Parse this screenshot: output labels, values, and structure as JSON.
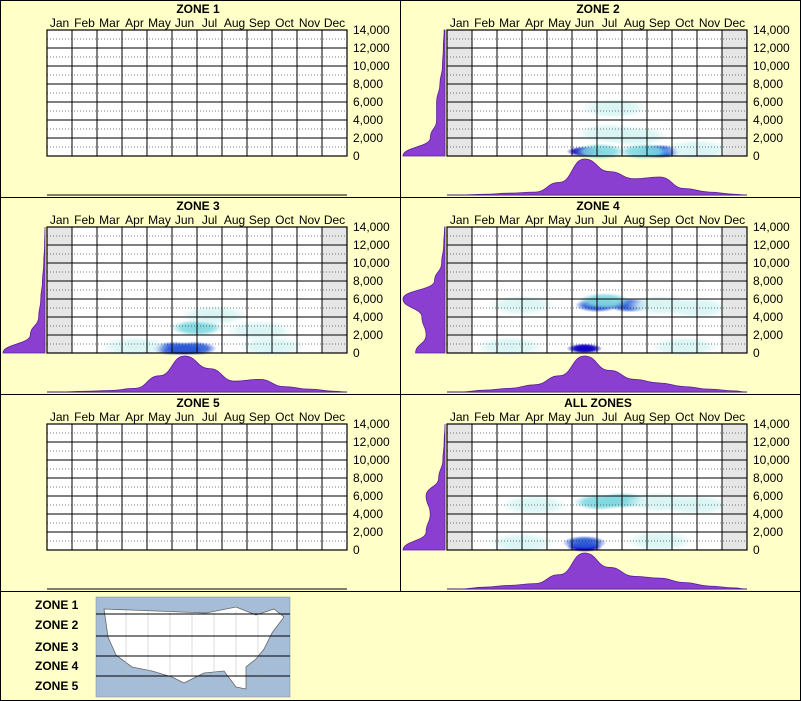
{
  "months": [
    "Jan",
    "Feb",
    "Mar",
    "Apr",
    "May",
    "Jun",
    "Jul",
    "Aug",
    "Sep",
    "Oct",
    "Nov",
    "Dec"
  ],
  "y_ticks": [
    "0",
    "2,000",
    "4,000",
    "6,000",
    "8,000",
    "10,000",
    "12,000",
    "14,000"
  ],
  "colors": {
    "background": "#ffffc8",
    "profile_fill": "#8b3fd0",
    "grid": "#000000",
    "inactive_shade": "#e6e6e6",
    "density_low": "#d8f4f4",
    "density_mid": "#7fd8e0",
    "density_high": "#0000c8",
    "density_peak": "#e8158c"
  },
  "chart_data": [
    {
      "type": "heatmap",
      "panel_index": 0,
      "title": "ZONE 1",
      "ylim": [
        0,
        14000
      ],
      "has_data": false,
      "shaded_months": [],
      "density_cells": [],
      "month_profile": [],
      "elevation_profile": []
    },
    {
      "type": "heatmap",
      "panel_index": 1,
      "title": "ZONE 2",
      "ylim": [
        0,
        14000
      ],
      "has_data": true,
      "shaded_months": [
        0,
        11
      ],
      "density_cells": [
        {
          "month": 5.0,
          "elev": 500,
          "level": 4
        },
        {
          "month": 5.0,
          "elev": 500,
          "level": 3
        },
        {
          "month": 8.0,
          "elev": 500,
          "level": 3
        },
        {
          "month": 8.0,
          "elev": 500,
          "level": 2
        },
        {
          "month": 5.6,
          "elev": 500,
          "level": 1
        },
        {
          "month": 7.4,
          "elev": 500,
          "level": 1
        },
        {
          "month": 6.2,
          "elev": 5300,
          "level": 0
        },
        {
          "month": 6.0,
          "elev": 2500,
          "level": 0
        },
        {
          "month": 7.0,
          "elev": 2200,
          "level": 0
        },
        {
          "month": 9.5,
          "elev": 700,
          "level": 0
        }
      ],
      "month_profile": [
        0,
        0.02,
        0.05,
        0.08,
        0.35,
        1.0,
        0.65,
        0.45,
        0.5,
        0.18,
        0.08,
        0.02
      ],
      "elevation_profile": [
        1.0,
        0.35,
        0.2,
        0.2,
        0.12,
        0.06,
        0.04,
        0.02
      ]
    },
    {
      "type": "heatmap",
      "panel_index": 2,
      "title": "ZONE 3",
      "ylim": [
        0,
        14000
      ],
      "has_data": true,
      "shaded_months": [
        0,
        11
      ],
      "density_cells": [
        {
          "month": 5.0,
          "elev": 300,
          "level": 4
        },
        {
          "month": 5.0,
          "elev": 300,
          "level": 3
        },
        {
          "month": 4.6,
          "elev": 500,
          "level": 2
        },
        {
          "month": 5.4,
          "elev": 500,
          "level": 2
        },
        {
          "month": 5.5,
          "elev": 2800,
          "level": 1
        },
        {
          "month": 6.2,
          "elev": 4200,
          "level": 0
        },
        {
          "month": 3.0,
          "elev": 700,
          "level": 0
        },
        {
          "month": 8.5,
          "elev": 700,
          "level": 0
        },
        {
          "month": 8.0,
          "elev": 2500,
          "level": 0
        }
      ],
      "month_profile": [
        0,
        0.02,
        0.04,
        0.1,
        0.45,
        1.0,
        0.65,
        0.3,
        0.35,
        0.15,
        0.08,
        0.02
      ],
      "elevation_profile": [
        1.0,
        0.35,
        0.15,
        0.1,
        0.06,
        0.03,
        0.01,
        0.0
      ]
    },
    {
      "type": "heatmap",
      "panel_index": 3,
      "title": "ZONE 4",
      "ylim": [
        0,
        14000
      ],
      "has_data": true,
      "shaded_months": [
        0,
        11
      ],
      "density_cells": [
        {
          "month": 5.0,
          "elev": 500,
          "level": 4
        },
        {
          "month": 5.0,
          "elev": 500,
          "level": 3
        },
        {
          "month": 5.5,
          "elev": 5300,
          "level": 2
        },
        {
          "month": 6.8,
          "elev": 5300,
          "level": 2
        },
        {
          "month": 5.8,
          "elev": 5800,
          "level": 1
        },
        {
          "month": 8.0,
          "elev": 5300,
          "level": 0
        },
        {
          "month": 2.5,
          "elev": 5300,
          "level": 0
        },
        {
          "month": 9.5,
          "elev": 5000,
          "level": 0
        },
        {
          "month": 2.0,
          "elev": 700,
          "level": 0
        },
        {
          "month": 9.0,
          "elev": 700,
          "level": 0
        }
      ],
      "month_profile": [
        0,
        0.05,
        0.1,
        0.2,
        0.45,
        1.0,
        0.6,
        0.35,
        0.25,
        0.15,
        0.08,
        0.03
      ],
      "elevation_profile": [
        0.7,
        0.45,
        0.55,
        1.0,
        0.25,
        0.08,
        0.03,
        0.01
      ]
    },
    {
      "type": "heatmap",
      "panel_index": 4,
      "title": "ZONE 5",
      "ylim": [
        0,
        14000
      ],
      "has_data": false,
      "shaded_months": [],
      "density_cells": [],
      "month_profile": [],
      "elevation_profile": []
    },
    {
      "type": "heatmap",
      "panel_index": 5,
      "title": "ALL ZONES",
      "ylim": [
        0,
        14000
      ],
      "has_data": true,
      "shaded_months": [
        0,
        11
      ],
      "density_cells": [
        {
          "month": 5.0,
          "elev": 300,
          "level": 4
        },
        {
          "month": 5.0,
          "elev": 300,
          "level": 3
        },
        {
          "month": 5.0,
          "elev": 800,
          "level": 2
        },
        {
          "month": 5.6,
          "elev": 5300,
          "level": 1
        },
        {
          "month": 6.5,
          "elev": 5500,
          "level": 1
        },
        {
          "month": 8.0,
          "elev": 5300,
          "level": 0
        },
        {
          "month": 3.0,
          "elev": 5000,
          "level": 0
        },
        {
          "month": 9.5,
          "elev": 5000,
          "level": 0
        },
        {
          "month": 8.0,
          "elev": 1000,
          "level": 0
        },
        {
          "month": 2.5,
          "elev": 800,
          "level": 0
        }
      ],
      "month_profile": [
        0,
        0.05,
        0.1,
        0.15,
        0.4,
        1.0,
        0.6,
        0.35,
        0.3,
        0.18,
        0.08,
        0.03
      ],
      "elevation_profile": [
        1.0,
        0.45,
        0.35,
        0.45,
        0.15,
        0.05,
        0.02,
        0.0
      ]
    }
  ],
  "legend": {
    "zones": [
      "ZONE 1",
      "ZONE 2",
      "ZONE 3",
      "ZONE 4",
      "ZONE 5"
    ]
  }
}
